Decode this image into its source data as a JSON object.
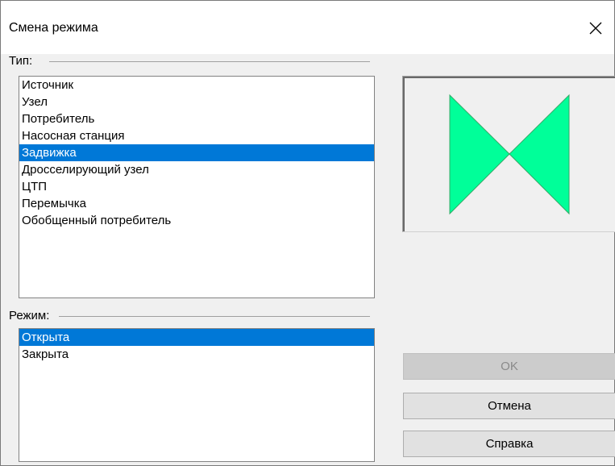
{
  "dialog": {
    "title": "Смена режима"
  },
  "type_group": {
    "label": "Тип:",
    "items": [
      {
        "label": "Источник",
        "selected": false
      },
      {
        "label": "Узел",
        "selected": false
      },
      {
        "label": "Потребитель",
        "selected": false
      },
      {
        "label": "Насосная станция",
        "selected": false
      },
      {
        "label": "Задвижка",
        "selected": true
      },
      {
        "label": "Дросселирующий узел",
        "selected": false
      },
      {
        "label": "ЦТП",
        "selected": false
      },
      {
        "label": "Перемычка",
        "selected": false
      },
      {
        "label": "Обобщенный потребитель",
        "selected": false
      }
    ]
  },
  "mode_group": {
    "label": "Режим:",
    "items": [
      {
        "label": "Открыта",
        "selected": true
      },
      {
        "label": "Закрыта",
        "selected": false
      }
    ]
  },
  "preview": {
    "icon": "valve-icon",
    "fill_color": "#00ff99",
    "stroke_color": "#33aa66"
  },
  "buttons": {
    "ok_label": "OK",
    "ok_enabled": false,
    "cancel_label": "Отмена",
    "help_label": "Справка"
  },
  "colors": {
    "selection": "#0078d7"
  }
}
